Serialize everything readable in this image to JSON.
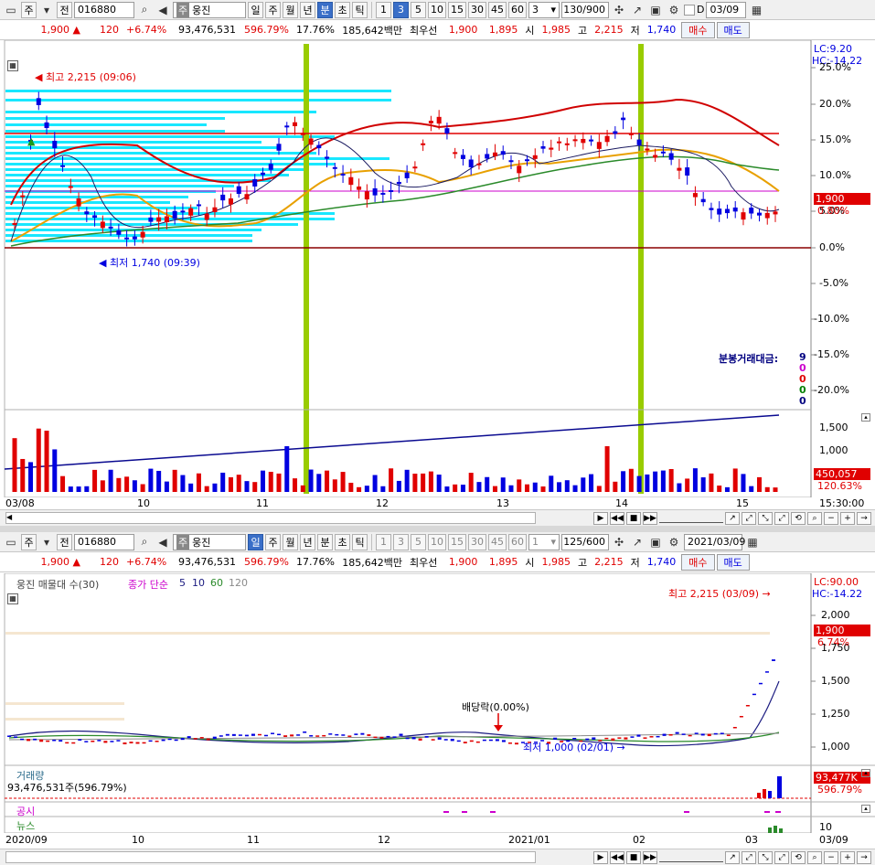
{
  "colors": {
    "up": "#e00000",
    "down": "#0000e0",
    "highlight_bar": "#99cc00",
    "volume_profile": "#00e5ff",
    "accent": "#3a6fc8"
  },
  "top": {
    "toolbar": {
      "market": "주",
      "prev": "전",
      "code": "016880",
      "stock_badge": "주",
      "stock_name": "웅진",
      "periods": [
        "일",
        "주",
        "월",
        "년",
        "분",
        "초",
        "틱"
      ],
      "selected_period": "분",
      "intervals": [
        "1",
        "3",
        "5",
        "10",
        "15",
        "30",
        "45",
        "60"
      ],
      "selected_interval": "3",
      "interval_value": "3",
      "count": "130",
      "count_max": "/900",
      "checkbox_label": "D",
      "date": "03/09"
    },
    "quote": {
      "price": "1,900 ▲",
      "change": "120",
      "change_pct": "+6.74%",
      "volume": "93,476,531",
      "volume_ratio": "596.79%",
      "turnover": "17.76%",
      "amount": "185,642백만",
      "best_label": "최우선",
      "ask": "1,900",
      "bid": "1,895",
      "open_label": "시",
      "open": "1,985",
      "high_label": "고",
      "high": "2,215",
      "low_label": "저",
      "low": "1,740",
      "buy": "매수",
      "sell": "매도"
    },
    "chart": {
      "lc": "LC:9.20",
      "hc": "HC:-14.22",
      "y_ticks": [
        "25.0%",
        "20.0%",
        "15.0%",
        "10.0%",
        "5.0%",
        "0.0%",
        "-5.0%",
        "-10.0%",
        "-15.0%",
        "-20.0%"
      ],
      "price_tag": "1,900",
      "price_tag_pct": "0.80%",
      "high_marker": "최고 2,215 (09:06)",
      "low_marker": "최저 1,740 (09:39)",
      "volume_label": "분봉거래대금:",
      "volume_values": [
        "9",
        "0",
        "0",
        "0",
        "0"
      ],
      "vol_ticks": [
        "1,500",
        "1,000",
        "500"
      ],
      "vol_tag": "450,057",
      "vol_pct": "120.63%",
      "x_labels": [
        "03/08",
        "10",
        "11",
        "12",
        "13",
        "14",
        "15",
        "15:30:00"
      ]
    }
  },
  "bottom": {
    "toolbar": {
      "market": "주",
      "prev": "전",
      "code": "016880",
      "stock_badge": "주",
      "stock_name": "웅진",
      "periods": [
        "일",
        "주",
        "월",
        "년",
        "분",
        "초",
        "틱"
      ],
      "selected_period": "일",
      "intervals": [
        "1",
        "3",
        "5",
        "10",
        "15",
        "30",
        "45",
        "60"
      ],
      "interval_value": "1",
      "count": "125",
      "count_max": "/600",
      "date": "2021/03/09"
    },
    "quote": {
      "price": "1,900 ▲",
      "change": "120",
      "change_pct": "+6.74%",
      "volume": "93,476,531",
      "volume_ratio": "596.79%",
      "turnover": "17.76%",
      "amount": "185,642백만",
      "best_label": "최우선",
      "ask": "1,900",
      "bid": "1,895",
      "open_label": "시",
      "open": "1,985",
      "high_label": "고",
      "high": "2,215",
      "low_label": "저",
      "low": "1,740",
      "buy": "매수",
      "sell": "매도"
    },
    "chart": {
      "legend_name": "웅진 매물대 수(30)",
      "ma_label": "종가 단순",
      "ma_periods": [
        "5",
        "10",
        "60",
        "120"
      ],
      "lc": "LC:90.00",
      "hc": "HC:-14.22",
      "y_ticks": [
        "2,000",
        "1,750",
        "1,500",
        "1,250",
        "1,000"
      ],
      "price_tag": "1,900",
      "price_tag_pct": "6.74%",
      "high_marker": "최고 2,215 (03/09)",
      "low_marker": "최저 1,000 (02/01)",
      "dividend_marker": "배당락(0.00%)",
      "volume_title": "거래량",
      "volume_text": "93,476,531주(596.79%)",
      "vol_tag": "93,477K",
      "vol_pct": "596.79%",
      "disclosure": "공시",
      "news": "뉴스",
      "news_tick": "10",
      "x_labels": [
        "2020/09",
        "10",
        "11",
        "12",
        "2021/01",
        "02",
        "03",
        "03/09"
      ]
    }
  }
}
